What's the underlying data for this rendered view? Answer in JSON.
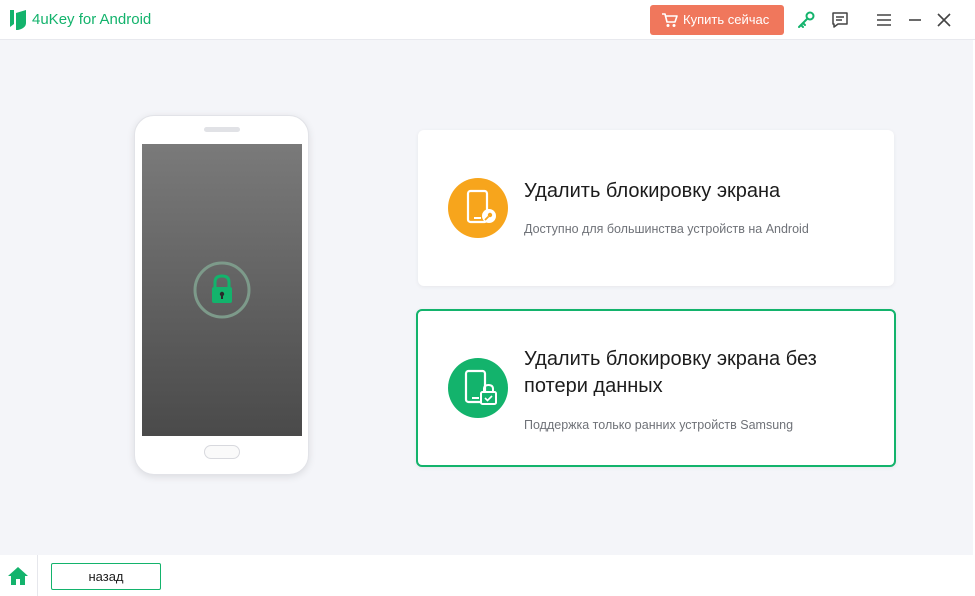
{
  "titlebar": {
    "app_title": "4uKey for Android",
    "buy_label": "Купить сейчас",
    "icons": [
      "key-icon",
      "feedback-icon",
      "menu-icon",
      "minimize-icon",
      "close-icon"
    ]
  },
  "options": [
    {
      "title": "Удалить блокировку экрана",
      "subtitle": "Доступно для большинства устройств на Android",
      "icon": "phone-key-icon",
      "color": "#f7a51c"
    },
    {
      "title": "Удалить блокировку экрана без потери данных",
      "subtitle": "Поддержка только ранних устройств Samsung",
      "icon": "phone-lock-icon",
      "color": "#13b36c",
      "selected": true
    }
  ],
  "footer": {
    "back_label": "назад"
  },
  "colors": {
    "brand": "#13b36c",
    "buy": "#f0775c",
    "accent": "#f7a51c"
  }
}
